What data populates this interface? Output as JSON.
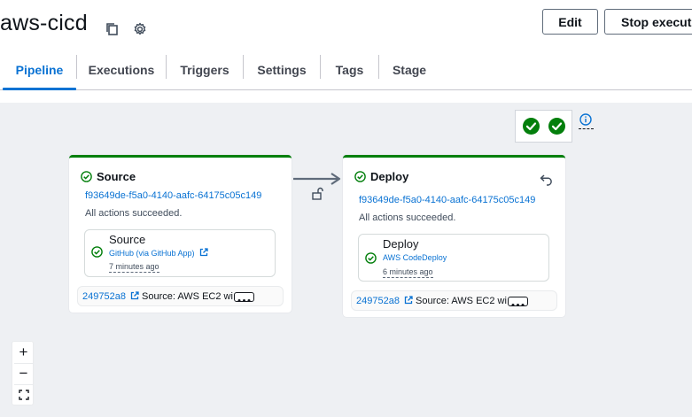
{
  "header": {
    "title": "aws-cicd",
    "copy_icon": "copy-icon",
    "settings_icon": "gear-icon",
    "edit_label": "Edit",
    "stop_label": "Stop executio"
  },
  "tabs": [
    {
      "label": "Pipeline",
      "active": true
    },
    {
      "label": "Executions"
    },
    {
      "label": "Triggers"
    },
    {
      "label": "Settings"
    },
    {
      "label": "Tags"
    },
    {
      "label": "Stage"
    }
  ],
  "overview": {
    "status_icons": [
      "success-check-icon",
      "success-check-icon"
    ],
    "info_icon": "info-icon"
  },
  "stages": [
    {
      "name": "Source",
      "execution_id": "f93649de-f5a0-4140-aafc-64175c05c149",
      "status": "All actions succeeded.",
      "action": {
        "name": "Source",
        "provider": "GitHub (via GitHub App)",
        "time": "7 minutes ago"
      },
      "revision": {
        "id": "249752a8",
        "text": "Source: AWS EC2 wi"
      }
    },
    {
      "name": "Deploy",
      "execution_id": "f93649de-f5a0-4140-aafc-64175c05c149",
      "status": "All actions succeeded.",
      "action": {
        "name": "Deploy",
        "provider": "AWS CodeDeploy",
        "time": "6 minutes ago"
      },
      "revision": {
        "id": "249752a8",
        "text": "Source: AWS EC2 wi"
      }
    }
  ],
  "transition_icon": "unlock-icon",
  "rollback_icon": "undo-icon",
  "zoom": {
    "in": "+",
    "out": "−",
    "fit_icon": "fit-view-icon"
  },
  "colors": {
    "accent": "#0972d3",
    "success": "#037f0c",
    "canvas": "#eef0f3"
  }
}
